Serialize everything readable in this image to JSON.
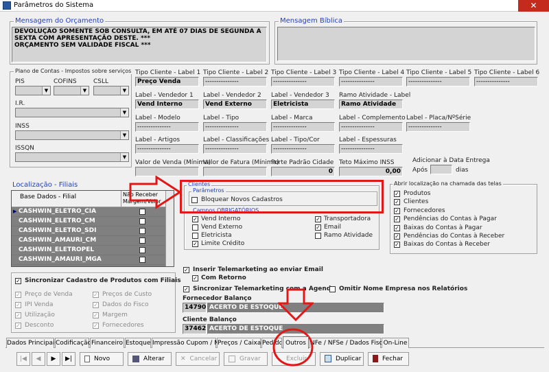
{
  "window": {
    "title": "Parâmetros do Sistema",
    "close": "✕"
  },
  "orcamento": {
    "label": "Mensagem do Orçamento",
    "text": "DEVOLUÇÃO SOMENTE SOB CONSULTA, EM ATÉ 07 DIAS DE SEGUNDA A\nSEXTA COM APRESENTAÇÃO DESTE.                                          ***\nORÇAMENTO SEM VALIDADE FISCAL  ***"
  },
  "biblica": {
    "label": "Mensagem Bíblica",
    "text": ""
  },
  "impostos": {
    "label": "Plano de Contas - Impostos sobre serviços",
    "pis": "PIS",
    "cofins": "COFINS",
    "csll": "CSLL",
    "ir": "I.R.",
    "inss": "INSS",
    "issqn": "ISSQN"
  },
  "tipo_cliente": {
    "l1": "Tipo Cliente - Label 1",
    "v1": "Preço Venda",
    "l2": "Tipo Cliente - Label 2",
    "v2": "---------------",
    "l3": "Tipo Cliente - Label 3",
    "v3": "---------------",
    "l4": "Tipo Cliente - Label 4",
    "v4": "---------------",
    "l5": "Tipo Cliente - Label 5",
    "v5": "---------------",
    "l6": "Tipo Cliente - Label 6",
    "v6": "---------------"
  },
  "vendedor": {
    "l1": "Label - Vendedor 1",
    "v1": "Vend Interno",
    "l2": "Label - Vendedor 2",
    "v2": "Vend Externo",
    "l3": "Label - Vendedor 3",
    "v3": "Eletricista",
    "l4": "Ramo Atividade - Label",
    "v4": "Ramo Atividade"
  },
  "labels_row3": {
    "l1": "Label - Modelo",
    "v1": "---------------",
    "l2": "Label - Tipo",
    "v2": "---------------",
    "l3": "Label - Marca",
    "v3": "---------------",
    "l4": "Label - Complemento",
    "v4": "---------------",
    "l5": "Label - Placa/NºSérie",
    "v5": "---------------"
  },
  "labels_row4": {
    "l1": "Label - Artigos",
    "v1": "---------------",
    "l2": "Label - Classificações",
    "v2": "---------------",
    "l3": "Label - Tipo/Cor",
    "v3": "---------------",
    "l4": "Label - Espessuras",
    "v4": "---------------"
  },
  "valores": {
    "venda": "Valor de Venda (Mínima)",
    "fatura": "Valor de Fatura (Mínima)",
    "cidade": "Porte Padrão Cidade",
    "cidade_val": "0",
    "inss": "Teto Máximo INSS",
    "inss_val": "0,00",
    "entrega": "Adicionar à Data Entrega",
    "apos": "Após",
    "dias": "dias"
  },
  "filiais": {
    "label": "Localização - Filiais",
    "col1": "Base Dados - Filial",
    "col2": "Não Receber Margem/Valor",
    "rows": [
      "CASHWIN_ELETRO_CIA",
      "CASHWIN_ELETRO_CM",
      "CASHWIN_ELETRO_SDI",
      "CASHWIN_AMAURI_CM",
      "CASHWIN_ELETROPEL",
      "CASHWIN_AMAURI_MGA"
    ]
  },
  "sync": {
    "label": "Sincronizar Cadastro de Produtos com Filiais",
    "items": [
      "Preço de Venda",
      "Preços de Custo",
      "IPI Venda",
      "Dados do Fisco",
      "Utilização",
      "Margem",
      "Desconto",
      "Fornecedores"
    ]
  },
  "clientes": {
    "label": "Clientes",
    "param": "Parâmetros",
    "bloquear": "Bloquear Novos Cadastros",
    "obrig": "Campos OBRIGATÓRIOS",
    "c1": "Vend Interno",
    "c2": "Vend Externo",
    "c3": "Eletricista",
    "c4": "Limite Crédito",
    "c5": "Transportadora",
    "c6": "Email",
    "c7": "Ramo Atividade"
  },
  "abrir": {
    "label": "Abrir localização na chamada das telas",
    "items": [
      "Produtos",
      "Clientes",
      "Fornecedores",
      "Pendências do Contas à Pagar",
      "Baixas do Contas à Pagar",
      "Pendências do Contas à Receber",
      "Baixas do Contas à Receber"
    ]
  },
  "tele": {
    "email": "Inserir Telemarketing ao enviar Email",
    "retorno": "Com Retorno",
    "agenda": "Sincronizar Telemarketing com a Agenda",
    "omitir": "Omitir Nome Empresa nos Relatórios"
  },
  "forn": {
    "label": "Fornecedor Balanço",
    "code": "14790",
    "name": "ACERTO DE ESTOQUE"
  },
  "cli": {
    "label": "Cliente Balanço",
    "code": "37462",
    "name": "ACERTO DE ESTOQUE"
  },
  "tabs": [
    "Dados Principais",
    "Codificação",
    "Financeiro",
    "Estoque",
    "Impressão Cupom / NF",
    "Preços / Caixa",
    "Pedido",
    "Outros",
    "NFe / NFSe / Dados Fisco",
    "On-Line"
  ],
  "buttons": {
    "novo": "Novo",
    "alterar": "Alterar",
    "cancelar": "Cancelar",
    "gravar": "Gravar",
    "excluir": "Excluir",
    "duplicar": "Duplicar",
    "fechar": "Fechar"
  },
  "nav": {
    "first": "|◀",
    "prev": "◀",
    "next": "▶",
    "last": "▶|"
  },
  "marks": {
    "check": "✓",
    "dropdown": "▼",
    "row_pointer": "▶",
    "blank": ""
  },
  "colors": {
    "highlight": "#e01818",
    "link_blue": "#1f3fbf",
    "label_red": "#cc0000"
  }
}
